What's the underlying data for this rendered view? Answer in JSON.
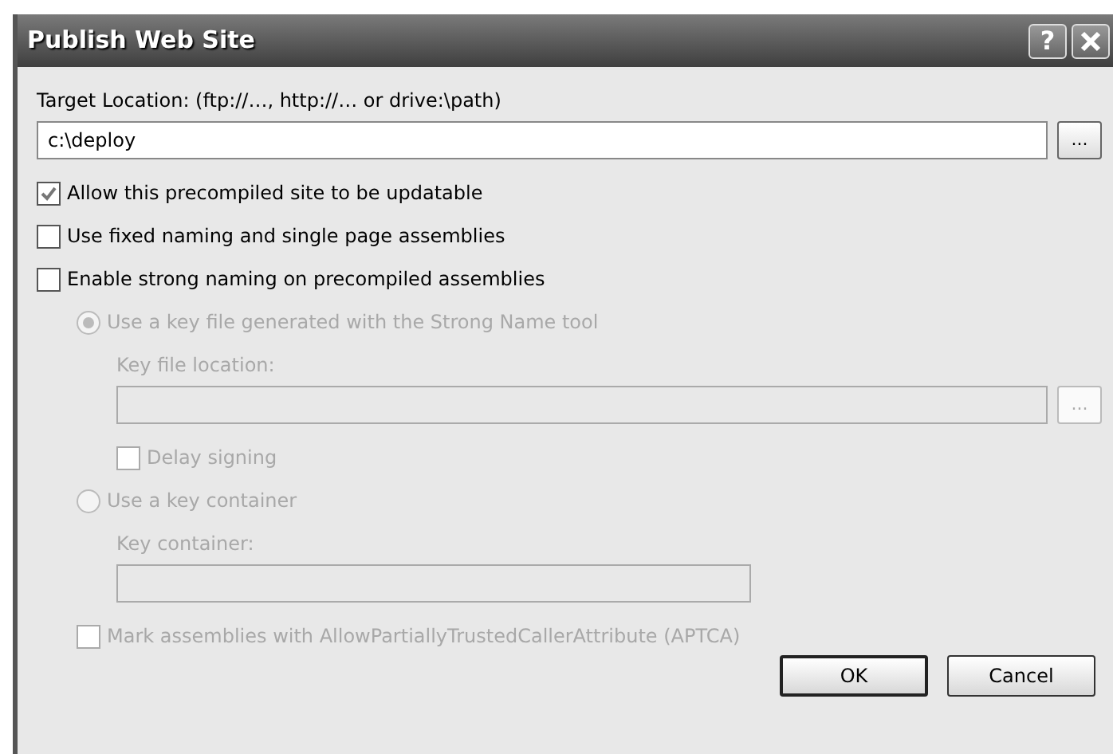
{
  "window": {
    "title": "Publish Web Site",
    "help": "?"
  },
  "items": [
    {
      "kind": "label",
      "text": "Target Location: (ftp://…, http://… or drive:\\path)",
      "disabled": false
    },
    {
      "kind": "path",
      "value": "c:\\deploy",
      "browse": "...",
      "disabled": false
    },
    {
      "kind": "checkbox",
      "text": "Allow this precompiled site to be updatable",
      "checked": true,
      "disabled": false
    },
    {
      "kind": "checkbox",
      "text": "Use fixed naming and single page assemblies",
      "checked": false,
      "disabled": false
    },
    {
      "kind": "checkbox",
      "text": "Enable strong naming on precompiled assemblies",
      "checked": false,
      "disabled": false,
      "children": [
        {
          "kind": "radio",
          "text": "Use a key file generated with the Strong Name tool",
          "selected": true,
          "disabled": true,
          "children": [
            {
              "kind": "label",
              "text": "Key file location:",
              "disabled": true
            },
            {
              "kind": "path",
              "browse": "...",
              "disabled": true
            },
            {
              "kind": "checkbox",
              "text": "Delay signing",
              "checked": false,
              "disabled": true
            }
          ]
        },
        {
          "kind": "radio",
          "text": "Use a key container",
          "selected": false,
          "disabled": true,
          "children": [
            {
              "kind": "label",
              "text": "Key container:",
              "disabled": true
            },
            {
              "kind": "field",
              "disabled": true
            }
          ]
        },
        {
          "kind": "checkbox",
          "text": "Mark assemblies with AllowPartiallyTrustedCallerAttribute (APTCA)",
          "checked": false,
          "disabled": true
        }
      ]
    }
  ],
  "buttons": [
    {
      "label": "OK",
      "default": true
    },
    {
      "label": "Cancel",
      "default": false
    }
  ]
}
